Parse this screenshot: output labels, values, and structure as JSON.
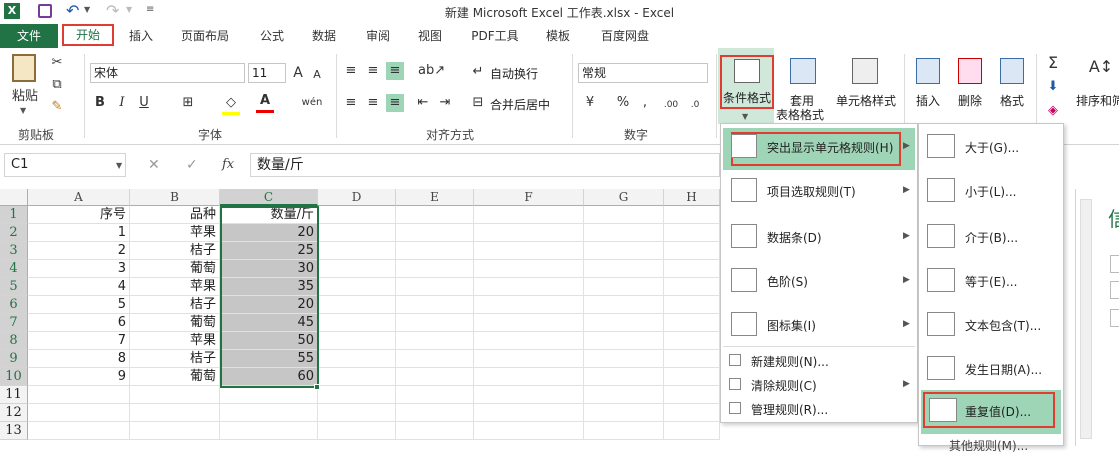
{
  "title": "新建 Microsoft Excel 工作表.xlsx - Excel",
  "tabs": [
    "文件",
    "开始",
    "插入",
    "页面布局",
    "公式",
    "数据",
    "审阅",
    "视图",
    "PDF工具",
    "模板",
    "百度网盘"
  ],
  "ribbon": {
    "paste": "粘贴",
    "clipboard": "剪贴板",
    "font_name": "宋体",
    "font_size": "11",
    "font_group": "字体",
    "bold": "B",
    "italic": "I",
    "underline": "U",
    "wrap": "自动换行",
    "merge": "合并后居中",
    "align_group": "对齐方式",
    "number_format": "常规",
    "number_group": "数字",
    "cond_format": "条件格式",
    "table_format_1": "套用",
    "table_format_2": "表格格式",
    "cell_style": "单元格样式",
    "insert": "插入",
    "delete": "删除",
    "format": "格式",
    "sort": "排序和筛",
    "font_grow": "A",
    "font_shrink": "A",
    "percent": "%",
    "comma": ","
  },
  "formula": {
    "namebox": "C1",
    "content": "数量/斤",
    "fx": "fx"
  },
  "columns": [
    "A",
    "B",
    "C",
    "D",
    "E",
    "F",
    "G",
    "H"
  ],
  "rows": [
    [
      "序号",
      "品种",
      "数量/斤"
    ],
    [
      "1",
      "苹果",
      "20"
    ],
    [
      "2",
      "桔子",
      "25"
    ],
    [
      "3",
      "葡萄",
      "30"
    ],
    [
      "4",
      "苹果",
      "35"
    ],
    [
      "5",
      "桔子",
      "20"
    ],
    [
      "6",
      "葡萄",
      "45"
    ],
    [
      "7",
      "苹果",
      "50"
    ],
    [
      "8",
      "桔子",
      "55"
    ],
    [
      "9",
      "葡萄",
      "60"
    ],
    [
      "",
      "",
      ""
    ],
    [
      "",
      "",
      ""
    ],
    [
      "",
      "",
      ""
    ]
  ],
  "menu1": {
    "items": [
      "突出显示单元格规则(H)",
      "项目选取规则(T)",
      "数据条(D)",
      "色阶(S)",
      "图标集(I)"
    ],
    "small": [
      "新建规则(N)...",
      "清除规则(C)",
      "管理规则(R)..."
    ]
  },
  "menu2": {
    "items": [
      "大于(G)...",
      "小于(L)...",
      "介于(B)...",
      "等于(E)...",
      "文本包含(T)...",
      "发生日期(A)...",
      "重复值(D)..."
    ],
    "more": "其他规则(M)..."
  },
  "colors": {
    "excel_green": "#217346",
    "highlight": "#9fd5b7",
    "selection": "#c6c6c6",
    "red_box": "#e03c31"
  }
}
